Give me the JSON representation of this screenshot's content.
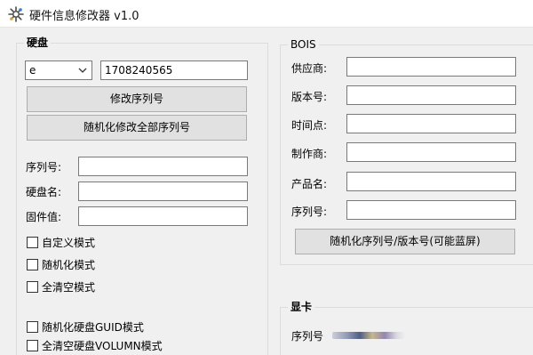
{
  "window": {
    "title": "硬件信息修改器 v1.0",
    "app_icon": "gear-cluster-icon"
  },
  "disk": {
    "group_title": "硬盘",
    "drive_select": "e",
    "drive_serial": "1708240565",
    "modify_serial_button": "修改序列号",
    "random_all_button": "随机化修改全部序列号",
    "serial_label": "序列号:",
    "serial_value": "",
    "disk_name_label": "硬盘名:",
    "disk_name_value": "",
    "firmware_label": "固件值:",
    "firmware_value": "",
    "modes": [
      {
        "label": "自定义模式",
        "checked": false
      },
      {
        "label": "随机化模式",
        "checked": false
      },
      {
        "label": "全清空模式",
        "checked": false
      }
    ],
    "guid_random_label": "随机化硬盘GUID模式",
    "volumn_clear_label": "全清空硬盘VOLUMN模式"
  },
  "bios": {
    "group_title": "BOIS",
    "fields": [
      {
        "label": "供应商:",
        "value": ""
      },
      {
        "label": "版本号:",
        "value": ""
      },
      {
        "label": "时间点:",
        "value": ""
      },
      {
        "label": "制作商:",
        "value": ""
      },
      {
        "label": "产品名:",
        "value": ""
      },
      {
        "label": "序列号:",
        "value": ""
      }
    ],
    "random_button": "随机化序列号/版本号(可能蓝屏)"
  },
  "gpu": {
    "group_title": "显卡",
    "serial_label": "序列号"
  }
}
